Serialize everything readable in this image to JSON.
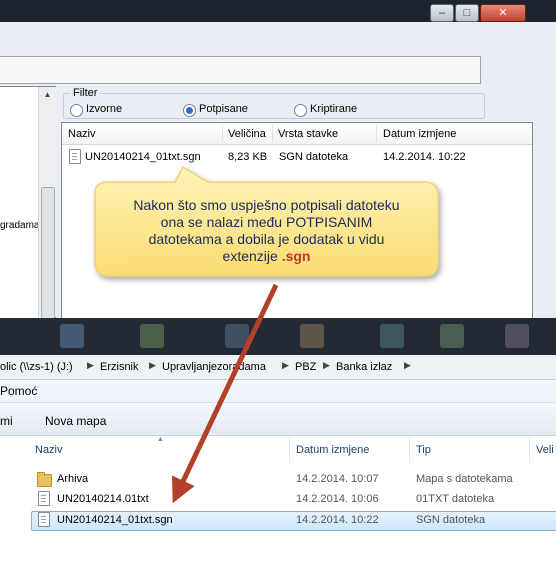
{
  "app_window": {
    "filter_title": "Filter",
    "filters": [
      {
        "label": "Izvorne",
        "selected": false
      },
      {
        "label": "Potpisane",
        "selected": true
      },
      {
        "label": "Kriptirane",
        "selected": false
      }
    ],
    "tree_label": "gradama",
    "columns": [
      "Naziv",
      "Veličina",
      "Vrsta stavke",
      "Datum izmjene"
    ],
    "file": {
      "name": "UN20140214_01txt.sgn",
      "size": "8,23 KB",
      "type": "SGN datoteka",
      "date": "14.2.2014. 10:22"
    }
  },
  "callout": {
    "line1": "Nakon što smo uspješno potpisali datoteku",
    "line2": "ona se nalazi među POTPISANIM",
    "line3": "datotekama   a dobila je dodatak u vidu",
    "line4_prefix": "extenzije ",
    "line4_highlight": ".sgn",
    "fill_color": "#fde68a",
    "highlight_color": "#c0392b"
  },
  "explorer": {
    "address": {
      "segments": [
        "olic (\\\\zs-1) (J:)",
        "Erzisnik",
        "Upravljanjezoradama",
        "PBZ",
        "Banka izlaz"
      ]
    },
    "menu": {
      "help": "Pomoć"
    },
    "toolbar": {
      "partial_item": "mi",
      "new_folder": "Nova mapa"
    },
    "columns": {
      "name": "Naziv",
      "date": "Datum izmjene",
      "type": "Tip",
      "size_partial": "Veli"
    },
    "rows": [
      {
        "name": "Arhiva",
        "date": "14.2.2014. 10:07",
        "type": "Mapa s datotekama",
        "icon": "folder-icon"
      },
      {
        "name": "UN20140214.01txt",
        "date": "14.2.2014. 10:06",
        "type": "01TXT datoteka",
        "icon": "document-icon"
      },
      {
        "name": "UN20140214_01txt.sgn",
        "date": "14.2.2014. 10:22",
        "type": "SGN datoteka",
        "icon": "document-icon",
        "selected": true
      }
    ]
  },
  "arrow_color": "#b4402a"
}
